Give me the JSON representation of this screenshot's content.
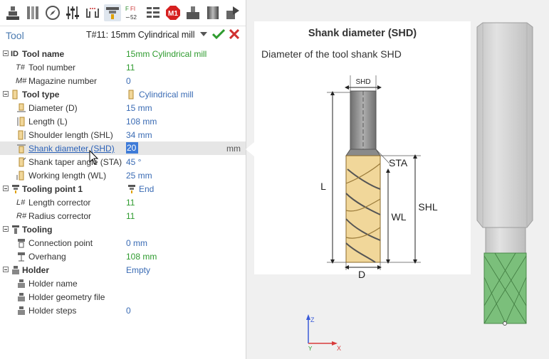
{
  "toolbar": {
    "icons": [
      "tool-holder-icon",
      "tool-assembly-icon",
      "compass-icon",
      "sliders-icon",
      "measure-icon",
      "tooling-point-icon",
      "feeds-icon",
      "list-icon",
      "m1-icon",
      "machine-icon",
      "cylinder-icon",
      "export-icon"
    ],
    "m1_label": "M1",
    "feeds_top": "F",
    "feeds_mid": "FI",
    "feeds_bottom": "52"
  },
  "header": {
    "label": "Tool",
    "selected_tool": "T#11: 15mm Cylindrical mill"
  },
  "properties": {
    "tool_name": {
      "label": "Tool name",
      "value": "15mm Cylindrical mill"
    },
    "tool_number": {
      "label": "Tool number",
      "value": "11"
    },
    "magazine_number": {
      "label": "Magazine number",
      "value": "0"
    },
    "tool_type": {
      "label": "Tool type",
      "value": "Cylindrical mill"
    },
    "diameter": {
      "label": "Diameter (D)",
      "value": "15 mm"
    },
    "length": {
      "label": "Length (L)",
      "value": "108 mm"
    },
    "shoulder_length": {
      "label": "Shoulder length (SHL)",
      "value": "34 mm"
    },
    "shank_diameter": {
      "label": "Shank diameter (SHD)",
      "value": "20",
      "unit": "mm"
    },
    "shank_taper_angle": {
      "label": "Shank taper angle (STA)",
      "value": "45 °"
    },
    "working_length": {
      "label": "Working length (WL)",
      "value": "25 mm"
    },
    "tooling_point": {
      "label": "Tooling point 1",
      "value": "End"
    },
    "length_corrector": {
      "label": "Length corrector",
      "value": "11"
    },
    "radius_corrector": {
      "label": "Radius corrector",
      "value": "11"
    },
    "tooling": {
      "label": "Tooling"
    },
    "connection_point": {
      "label": "Connection point",
      "value": "0 mm"
    },
    "overhang": {
      "label": "Overhang",
      "value": "108 mm"
    },
    "holder": {
      "label": "Holder",
      "value": "Empty"
    },
    "holder_name": {
      "label": "Holder name"
    },
    "holder_geometry_file": {
      "label": "Holder geometry file"
    },
    "holder_steps": {
      "label": "Holder steps",
      "value": "0"
    }
  },
  "prefixes": {
    "id": "ID",
    "tool_number": "T#",
    "magazine": "M#",
    "length_corr": "L#",
    "radius_corr": "R#"
  },
  "help": {
    "title": "Shank diameter (SHD)",
    "description": "Diameter of the tool shank SHD",
    "diagram_labels": {
      "shd": "SHD",
      "sta": "STA",
      "l": "L",
      "wl": "WL",
      "shl": "SHL",
      "d": "D"
    }
  },
  "axis": {
    "z": "Z",
    "y": "Y",
    "x": "X"
  },
  "colors": {
    "accent": "#3a6bb4",
    "value_green": "#2e9b2e",
    "flute": "#f1d79a",
    "shank": "#8d8d8d",
    "model_green": "#7bbf7b"
  }
}
